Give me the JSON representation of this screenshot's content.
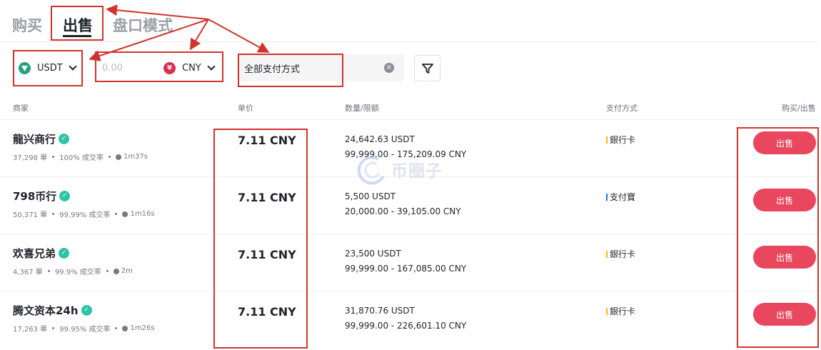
{
  "tabs": {
    "buy": "购买",
    "sell": "出售",
    "order_book": "盘口模式"
  },
  "filters": {
    "coin": "USDT",
    "amount_placeholder": "0.00",
    "currency": "CNY",
    "payment": "全部支付方式"
  },
  "columns": {
    "merchant": "商家",
    "price": "单价",
    "amount": "数量/限额",
    "payment": "支付方式",
    "action": "购买/出售"
  },
  "rows": [
    {
      "name": "龍兴商行",
      "orders": "37,298 單",
      "rate": "100% 成交率",
      "time": "1m37s",
      "price": "7.11 CNY",
      "available": "24,642.63 USDT",
      "limit": "99,999.00 - 175,209.09 CNY",
      "payment": "銀行卡",
      "payment_color": "#f0b90b",
      "action": "出售"
    },
    {
      "name": "798币行",
      "orders": "50,371 單",
      "rate": "99.99% 成交率",
      "time": "1m16s",
      "price": "7.11 CNY",
      "available": "5,500 USDT",
      "limit": "20,000.00 - 39,105.00 CNY",
      "payment": "支付寶",
      "payment_color": "#1677ff",
      "action": "出售"
    },
    {
      "name": "欢喜兄弟",
      "orders": "4,367 單",
      "rate": "99.9% 成交率",
      "time": "2m",
      "price": "7.11 CNY",
      "available": "23,500 USDT",
      "limit": "99,999.00 - 167,085.00 CNY",
      "payment": "銀行卡",
      "payment_color": "#f0b90b",
      "action": "出售"
    },
    {
      "name": "腾文资本24h",
      "orders": "17,263 單",
      "rate": "99.95% 成交率",
      "time": "1m26s",
      "price": "7.11 CNY",
      "available": "31,870.76 USDT",
      "limit": "99,999.00 - 226,601.10 CNY",
      "payment": "銀行卡",
      "payment_color": "#f0b90b",
      "action": "出售"
    }
  ],
  "watermark": "币圈子",
  "colors": {
    "sell": "#e8475d",
    "annotation": "#d0332d",
    "usdt": "#26a17b",
    "cny": "#d9304e"
  }
}
